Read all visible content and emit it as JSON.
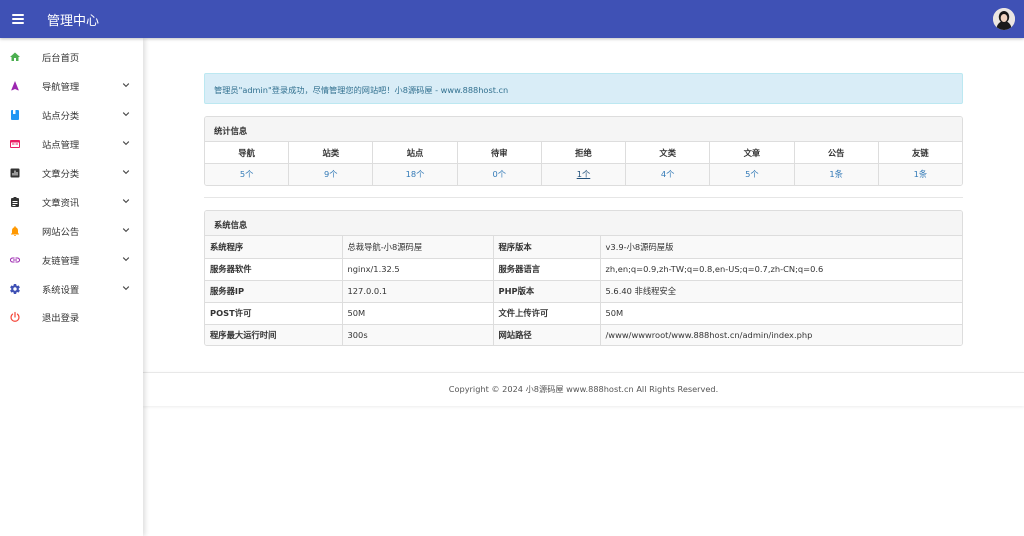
{
  "header": {
    "title": "管理中心",
    "bg_color": "#3f51b5",
    "menu_icon": "hamburger-menu-icon",
    "avatar": "user-avatar"
  },
  "sidebar": {
    "items": [
      {
        "label": "后台首页",
        "icon": "home-icon",
        "icon_color": "#4caf50",
        "has_submenu": false
      },
      {
        "label": "导航管理",
        "icon": "navigation-icon",
        "icon_color": "#9c27b0",
        "has_submenu": true
      },
      {
        "label": "站点分类",
        "icon": "book-icon",
        "icon_color": "#2196f3",
        "has_submenu": true
      },
      {
        "label": "站点管理",
        "icon": "browser-window-icon",
        "icon_color": "#e91e63",
        "has_submenu": true
      },
      {
        "label": "文章分类",
        "icon": "bar-chart-icon",
        "icon_color": "#333333",
        "has_submenu": true
      },
      {
        "label": "文章资讯",
        "icon": "clipboard-icon",
        "icon_color": "#333333",
        "has_submenu": true
      },
      {
        "label": "网站公告",
        "icon": "bell-icon",
        "icon_color": "#ff9800",
        "has_submenu": true
      },
      {
        "label": "友链管理",
        "icon": "link-icon",
        "icon_color": "#9c27b0",
        "has_submenu": true
      },
      {
        "label": "系统设置",
        "icon": "gear-icon",
        "icon_color": "#3f51b5",
        "has_submenu": true
      },
      {
        "label": "退出登录",
        "icon": "power-icon",
        "icon_color": "#f44336",
        "has_submenu": false
      }
    ]
  },
  "alert": {
    "text": "管理员\"admin\"登录成功，尽情管理您的网站吧！小8源码屋 - www.888host.cn"
  },
  "stats": {
    "title": "统计信息",
    "columns": [
      {
        "label": "导航",
        "value": "5个"
      },
      {
        "label": "站类",
        "value": "9个"
      },
      {
        "label": "站点",
        "value": "18个"
      },
      {
        "label": "待审",
        "value": "0个"
      },
      {
        "label": "拒绝",
        "value": "1个"
      },
      {
        "label": "文类",
        "value": "4个"
      },
      {
        "label": "文章",
        "value": "5个"
      },
      {
        "label": "公告",
        "value": "1条"
      },
      {
        "label": "友链",
        "value": "1条"
      }
    ]
  },
  "system": {
    "title": "系统信息",
    "rows": [
      [
        "系统程序",
        "总裁导航-小8源码屋",
        "程序版本",
        "v3.9-小8源码屋版"
      ],
      [
        "服务器软件",
        "nginx/1.32.5",
        "服务器语言",
        "zh,en;q=0.9,zh-TW;q=0.8,en-US;q=0.7,zh-CN;q=0.6"
      ],
      [
        "服务器IP",
        "127.0.0.1",
        "PHP版本",
        "5.6.40 非线程安全"
      ],
      [
        "POST许可",
        "50M",
        "文件上传许可",
        "50M"
      ],
      [
        "程序最大运行时间",
        "300s",
        "网站路径",
        "/www/wwwroot/www.888host.cn/admin/index.php"
      ]
    ]
  },
  "footer": {
    "text": "Copyright © 2024 小8源码屋 www.888host.cn All Rights Reserved."
  }
}
